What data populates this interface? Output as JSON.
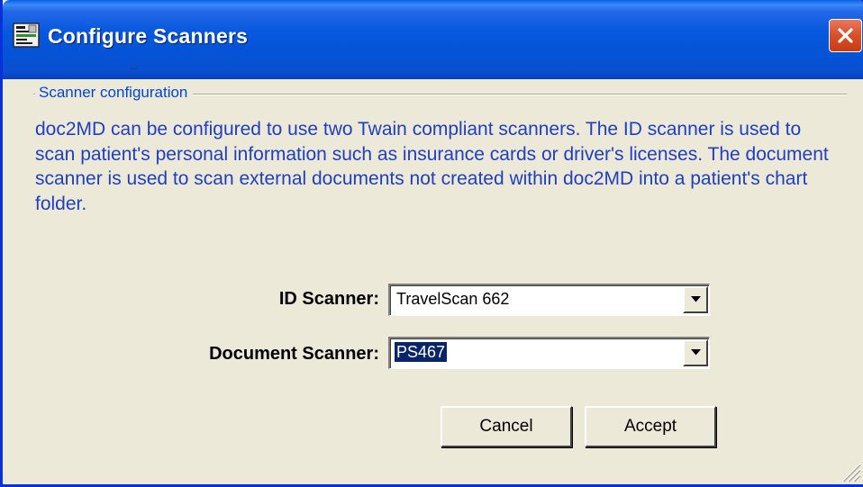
{
  "window": {
    "title": "Configure Scanners",
    "icons": {
      "app": "scanner-app-icon",
      "close": "close-icon"
    }
  },
  "menu": {
    "overflow": "..."
  },
  "group": {
    "label": "Scanner configuration"
  },
  "description": "doc2MD can be configured to use two Twain compliant scanners.  The ID scanner is used to scan patient's personal information such as insurance cards or driver's licenses.  The document scanner is used to scan external documents not created within doc2MD into a patient's chart folder.",
  "fields": {
    "id_scanner": {
      "label": "ID Scanner:",
      "value": "TravelScan 662"
    },
    "document_scanner": {
      "label": "Document Scanner:",
      "value": "PS467"
    }
  },
  "buttons": {
    "cancel": "Cancel",
    "accept": "Accept"
  },
  "colors": {
    "titlebar": "#0553d6",
    "close": "#d9522c",
    "accent_text": "#1f3fc2",
    "dialog_bg": "#ece9d8"
  }
}
